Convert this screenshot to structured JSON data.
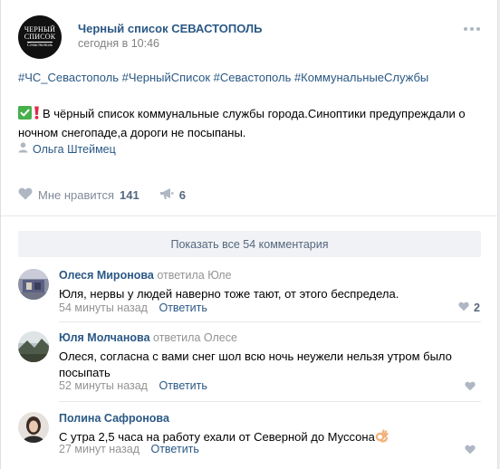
{
  "post": {
    "group_name": "Черный список СЕВАСТОПОЛЬ",
    "time": "сегодня в 10:46",
    "avatar_line1": "ЧЕРНЫЙ",
    "avatar_line2": "СПИСОК",
    "avatar_line3": "Севастополь",
    "hashtags": "#ЧС_Севастополь #ЧерныйСписок #Севастополь #КоммунальныеСлужбы",
    "text": "В чёрный список коммунальные службы города.Синоптики предупреждали о ночном снегопаде,а дороги не посыпаны.",
    "author": "Ольга Штеймец",
    "like_label": "Мне нравится",
    "like_count": "141",
    "share_count": "6"
  },
  "comments_section": {
    "show_all_label": "Показать все 54 комментария",
    "comments": [
      {
        "name": "Олеся Миронова",
        "reply_to": "ответила Юле",
        "text": "Юля, нервы у людей наверно тоже тают, от этого беспредела.",
        "time": "54 минуты назад",
        "reply_label": "Ответить",
        "likes": "2"
      },
      {
        "name": "Юля Молчанова",
        "reply_to": "ответила Олесе",
        "text": "Олеся, согласна с вами снег шол всю ночь неужели нельзя утром было посыпать",
        "time": "52 минуты назад",
        "reply_label": "Ответить",
        "likes": ""
      },
      {
        "name": "Полина Сафронова",
        "reply_to": "",
        "text": "С утра 2,5 часа на работу ехали от Северной до Муссона",
        "time": "27 минут назад",
        "reply_label": "Ответить",
        "likes": ""
      }
    ]
  },
  "icons": {
    "check": "white-check-mark-emoji",
    "exclamation": "red-exclamation-emoji",
    "author": "person-icon",
    "like": "heart-icon",
    "share": "megaphone-icon",
    "ok_hand": "ok-hand-emoji"
  },
  "colors": {
    "link": "#2a5885",
    "muted": "#828282",
    "accent_button_bg": "#f0f2f5",
    "check_green": "#47b04b",
    "exclamation_red": "#dd2e44"
  }
}
